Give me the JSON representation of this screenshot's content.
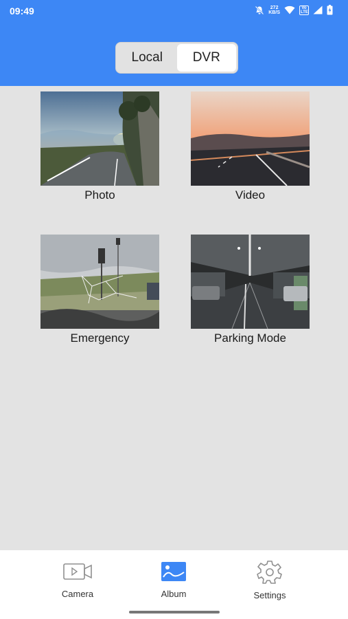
{
  "status_bar": {
    "time": "09:49",
    "network_speed_value": "272",
    "network_speed_unit": "KB/S",
    "network_type": "Vo LTE",
    "icons": [
      "mute-bell-icon",
      "wifi-icon",
      "volte-icon",
      "signal-icon",
      "battery-icon"
    ]
  },
  "header": {
    "tabs": [
      {
        "label": "Local",
        "selected": false
      },
      {
        "label": "DVR",
        "selected": true
      }
    ],
    "accent_color": "#3d87f5"
  },
  "albums": [
    {
      "label": "Photo"
    },
    {
      "label": "Video"
    },
    {
      "label": "Emergency"
    },
    {
      "label": "Parking Mode"
    }
  ],
  "bottom_nav": {
    "items": [
      {
        "label": "Camera",
        "icon": "camera-icon",
        "active": false
      },
      {
        "label": "Album",
        "icon": "album-icon",
        "active": true
      },
      {
        "label": "Settings",
        "icon": "settings-icon",
        "active": false
      }
    ]
  }
}
